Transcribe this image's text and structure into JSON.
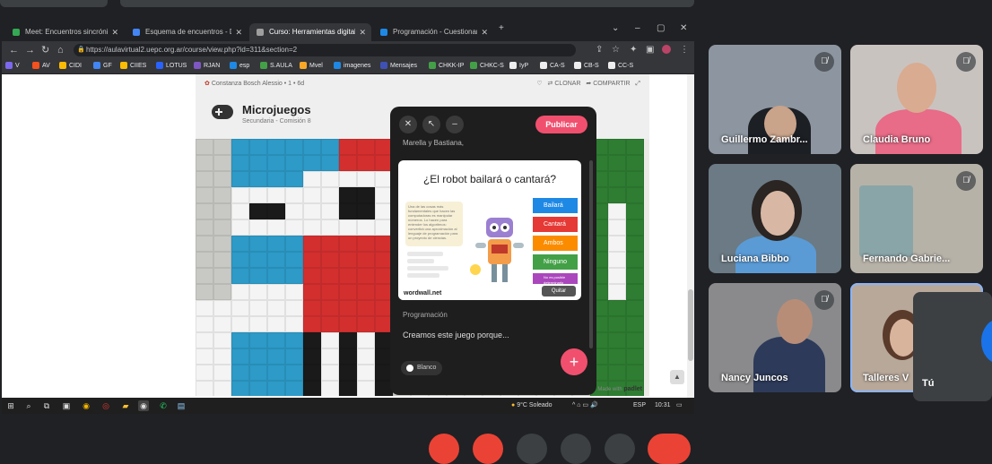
{
  "browser": {
    "tabs": [
      {
        "label": "Meet: Encuentros sincrónicos",
        "favicon_color": "#34a853"
      },
      {
        "label": "Esquema de encuentros - Docum",
        "favicon_color": "#4285f4"
      },
      {
        "label": "Curso: Herramientas digitales lúd",
        "favicon_color": "#9e9e9e",
        "active": true
      },
      {
        "label": "Programación - Cuestionario",
        "favicon_color": "#1e88e5"
      }
    ],
    "url": "https://aulavirtual2.uepc.org.ar/course/view.php?id=311&section=2",
    "bookmarks": [
      "V",
      "AV",
      "CIDI",
      "GF",
      "CIIES",
      "LOTUS",
      "RJAN",
      "esp",
      "S.AULA",
      "Mvel",
      "imagenes",
      "Mensajes",
      "CHKK-IP",
      "CHKC-S",
      "IyP",
      "CA-S",
      "CB-S",
      "CC-S"
    ]
  },
  "padlet": {
    "author": "Constanza Bosch Alessio",
    "meta": "• 1 • 6d",
    "clone_label": "CLONAR",
    "share_label": "COMPARTIR",
    "title": "Microjuegos",
    "subtitle": "Secundaria - Comisión 8",
    "made_with": "Made with",
    "made_with_brand": "padlet"
  },
  "modal": {
    "publish_label": "Publicar",
    "peek_text": "Marella y Bastiana,",
    "question": "¿El robot bailará o cantará?",
    "blurb": "Una de las cosas más fundamentales que hacen las computadoras es manipular números. Lo hacen para entender los algoritmos: convertirá una aproximación al lenguaje de programación para un proyecto de ciencias.",
    "answers": [
      {
        "label": "Bailará",
        "color": "#1e88e5"
      },
      {
        "label": "Cantará",
        "color": "#e53935"
      },
      {
        "label": "Ambos",
        "color": "#fb8c00"
      },
      {
        "label": "Ninguno",
        "color": "#43a047"
      },
      {
        "label": "No es posible determinarlo",
        "color": "#ab47bc"
      }
    ],
    "brand": "wordwall.net",
    "quit_label": "Quitar",
    "section_label": "Programación",
    "body_text": "Creamos este juego porque...",
    "color_chip": "Blanco"
  },
  "taskbar": {
    "weather": "9°C Soleado",
    "lang": "ESP",
    "time": "10:31"
  },
  "participants": [
    {
      "name": "Guillermo Zambr...",
      "muted": true,
      "bg": "#8d96a0"
    },
    {
      "name": "Claudia Bruno",
      "muted": true,
      "bg": "#c9c3c0"
    },
    {
      "name": "Luciana Bibbo",
      "muted": false,
      "bg": "#6b7a84"
    },
    {
      "name": "Fernando Gabrie...",
      "muted": true,
      "bg": "#b7b2a8"
    },
    {
      "name": "Nancy Juncos",
      "muted": true,
      "bg": "#8a8a8c"
    },
    {
      "name": "Talleres V",
      "muted": false,
      "bg": "#b8a89a",
      "speaking": true
    }
  ],
  "self_tile": {
    "name": "Tú"
  }
}
